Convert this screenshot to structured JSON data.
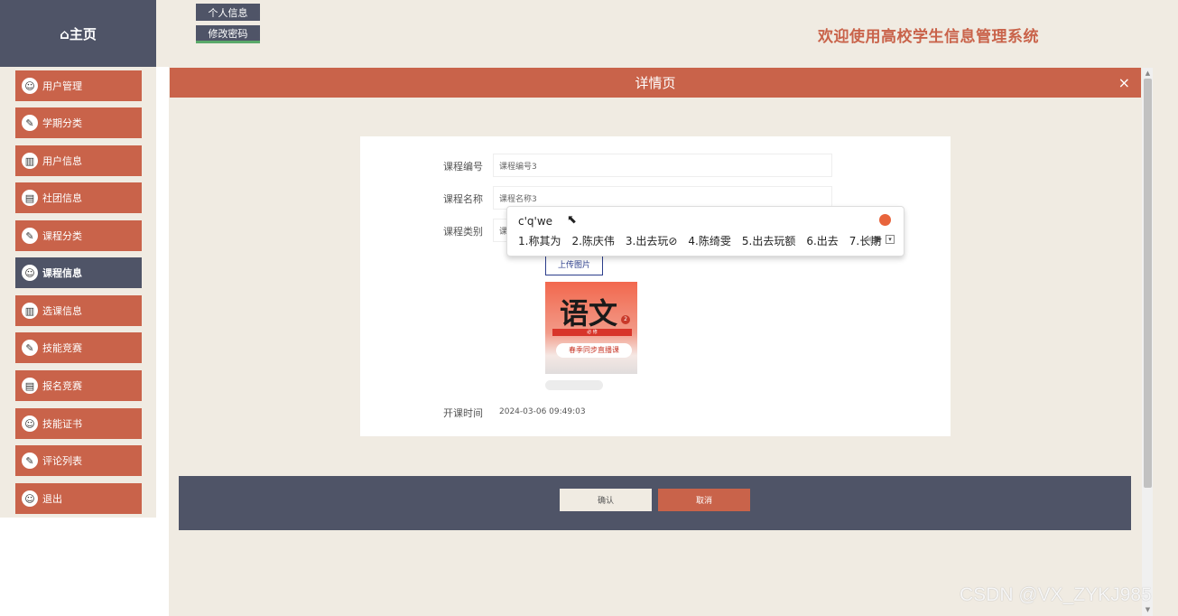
{
  "home": {
    "icon": "home-icon",
    "label": "⌂主页"
  },
  "topbar": {
    "profile_label": "个人信息",
    "password_label": "修改密码"
  },
  "site_title": "欢迎使用高校学生信息管理系统",
  "sidebar": {
    "items": [
      {
        "label": "用户管理",
        "icon": "user-manage-icon",
        "glyph": "☺",
        "active": false
      },
      {
        "label": "学期分类",
        "icon": "edit-icon",
        "glyph": "✎",
        "active": false
      },
      {
        "label": "用户信息",
        "icon": "chart-icon",
        "glyph": "▥",
        "active": false
      },
      {
        "label": "社团信息",
        "icon": "clipboard-icon",
        "glyph": "▤",
        "active": false
      },
      {
        "label": "课程分类",
        "icon": "edit-icon",
        "glyph": "✎",
        "active": false
      },
      {
        "label": "课程信息",
        "icon": "user-manage-icon",
        "glyph": "☺",
        "active": true
      },
      {
        "label": "选课信息",
        "icon": "chart-icon",
        "glyph": "▥",
        "active": false
      },
      {
        "label": "技能竞赛",
        "icon": "edit-icon",
        "glyph": "✎",
        "active": false
      },
      {
        "label": "报名竞赛",
        "icon": "clipboard-icon",
        "glyph": "▤",
        "active": false
      },
      {
        "label": "技能证书",
        "icon": "user-manage-icon",
        "glyph": "☺",
        "active": false
      },
      {
        "label": "评论列表",
        "icon": "edit-icon",
        "glyph": "✎",
        "active": false
      },
      {
        "label": "退出",
        "icon": "user-manage-icon",
        "glyph": "☺",
        "active": false
      }
    ]
  },
  "detail": {
    "title": "详情页",
    "close": "×",
    "fields": {
      "course_no_label": "课程编号",
      "course_no_value": "课程编号3",
      "course_name_label": "课程名称",
      "course_name_value": "课程名称3",
      "course_type_label": "课程类别",
      "course_type_value": "课",
      "upload_label": "上传图片",
      "image": {
        "title": "语文",
        "badge": "2",
        "subtitle": "必 修",
        "tag": "春季同步直播课"
      },
      "start_time_label": "开课时间",
      "start_time_value": "2024-03-06 09:49:03"
    },
    "confirm_label": "确认",
    "cancel_label": "取消"
  },
  "ime": {
    "input": "c'q'we",
    "candidates": [
      "1.称其为",
      "2.陈庆伟",
      "3.出去玩⊘",
      "4.陈绮雯",
      "5.出去玩额",
      "6.出去",
      "7.长期"
    ]
  },
  "watermark": "CSDN @VX_ZYKJ985"
}
